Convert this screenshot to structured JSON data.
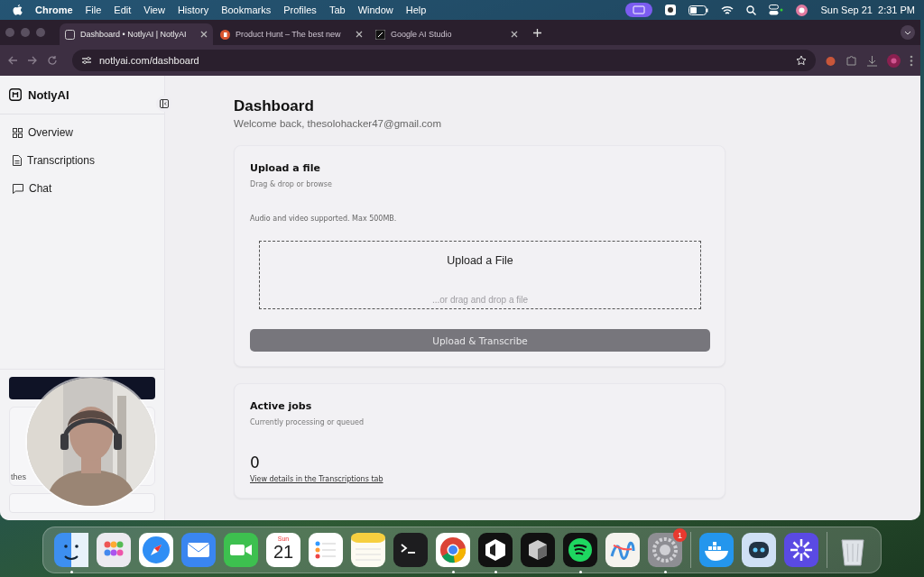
{
  "menubar": {
    "items": [
      {
        "label": "Chrome",
        "kind": "app"
      },
      {
        "label": "File",
        "kind": "menu"
      },
      {
        "label": "Edit",
        "kind": "menu"
      },
      {
        "label": "View",
        "kind": "menu"
      },
      {
        "label": "History",
        "kind": "menu"
      },
      {
        "label": "Bookmarks",
        "kind": "menu"
      },
      {
        "label": "Profiles",
        "kind": "menu"
      },
      {
        "label": "Tab",
        "kind": "menu"
      },
      {
        "label": "Window",
        "kind": "menu"
      },
      {
        "label": "Help",
        "kind": "menu"
      }
    ],
    "clock": "Sun Sep 21  2:31 PM"
  },
  "browser": {
    "tabs": [
      {
        "title": "Dashboard • NotlyAI | NotlyAI",
        "selected": true
      },
      {
        "title": "Product Hunt – The best new",
        "selected": false
      },
      {
        "title": "Google AI Studio",
        "selected": false
      }
    ],
    "url": "notlyai.com/dashboard"
  },
  "sidebar": {
    "brand": "NotlyAI",
    "items": [
      {
        "label": "Overview"
      },
      {
        "label": "Transcriptions"
      },
      {
        "label": "Chat"
      }
    ],
    "footer_text": "thes"
  },
  "page": {
    "title": "Dashboard",
    "subtitle": "Welcome back, thesolohacker47@gmail.com",
    "upload_card": {
      "title": "Upload a file",
      "subtitle": "Drag & drop or browse",
      "note": "Audio and video supported. Max 500MB.",
      "dropzone_title": "Upload a File",
      "dropzone_hint": "...or drag and drop a file",
      "button": "Upload & Transcribe",
      "button_disabled": true
    },
    "jobs_card": {
      "title": "Active jobs",
      "subtitle": "Currently processing or queued",
      "count": "0",
      "link": "View details in the Transcriptions tab"
    }
  },
  "dock": {
    "apps": [
      {
        "kind": "finder",
        "running": true
      },
      {
        "kind": "launchpad",
        "running": false
      },
      {
        "kind": "safari",
        "running": false
      },
      {
        "kind": "mail",
        "running": false
      },
      {
        "kind": "facetime",
        "running": false
      },
      {
        "kind": "calendar",
        "running": false,
        "day": "Sun",
        "date": "21"
      },
      {
        "kind": "reminders",
        "running": false
      },
      {
        "kind": "notes",
        "running": false
      },
      {
        "kind": "terminal",
        "running": false
      },
      {
        "kind": "chrome",
        "running": true
      },
      {
        "kind": "cursor",
        "running": true
      },
      {
        "kind": "box",
        "running": false
      },
      {
        "kind": "spotify",
        "running": true
      },
      {
        "kind": "freeform",
        "running": false
      },
      {
        "kind": "settings",
        "running": true,
        "badge": "1"
      },
      {
        "kind": "divider"
      },
      {
        "kind": "docker",
        "running": false
      },
      {
        "kind": "robot",
        "running": false
      },
      {
        "kind": "spark",
        "running": false
      },
      {
        "kind": "divider"
      },
      {
        "kind": "trash",
        "running": false
      }
    ]
  }
}
